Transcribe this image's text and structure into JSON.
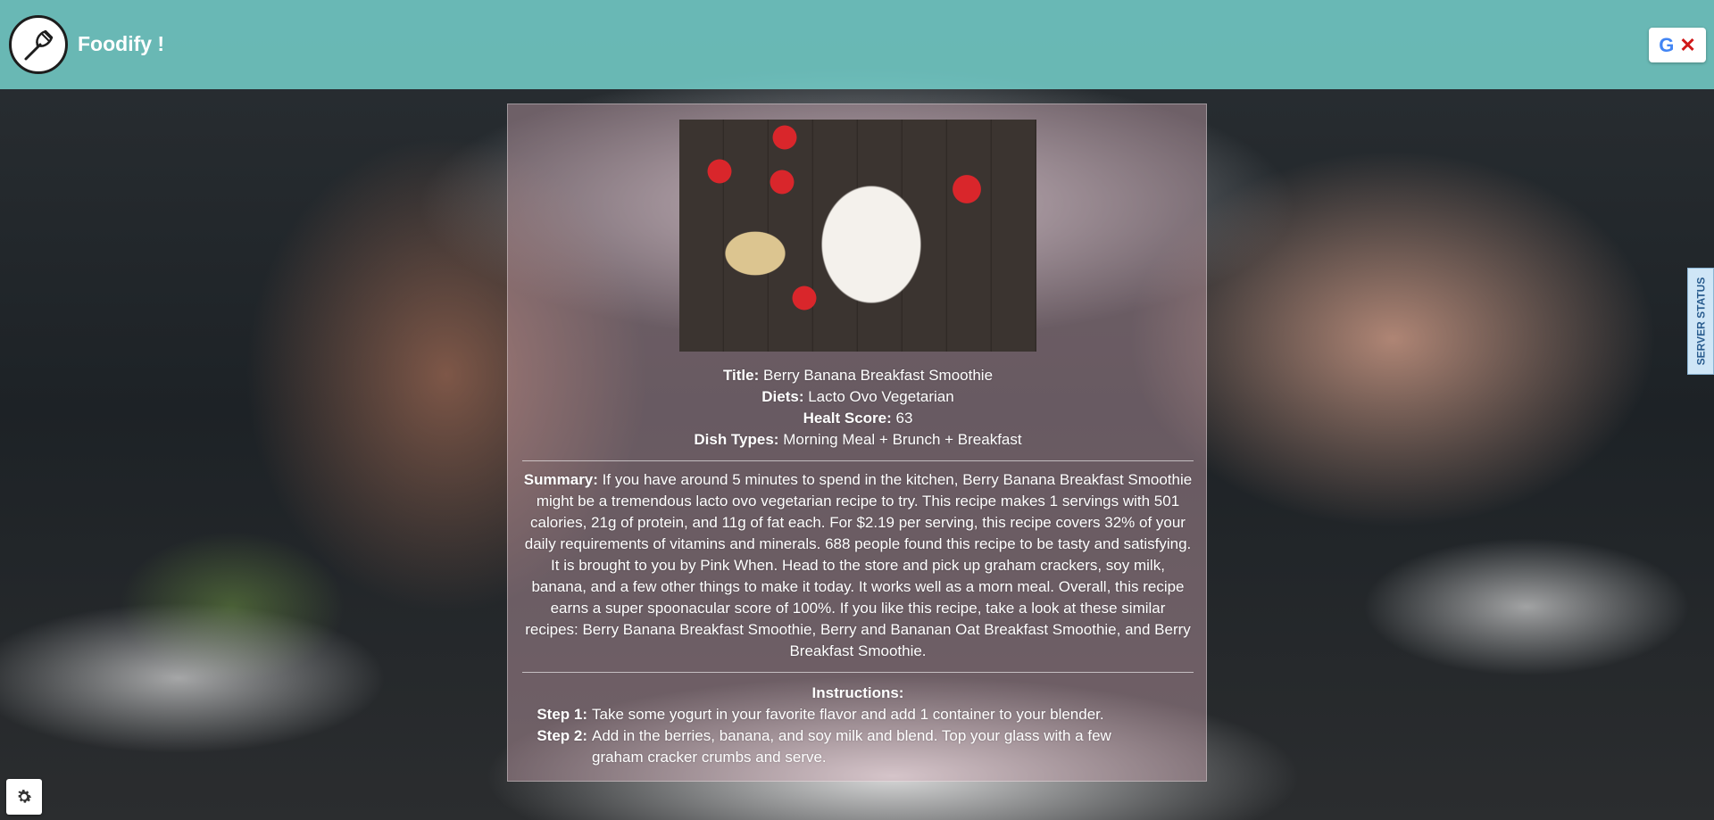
{
  "header": {
    "app_title": "Foodify !",
    "logo_icon": "fork-icon",
    "translate_icons": [
      "google-icon",
      "close-icon"
    ]
  },
  "sidebar": {
    "server_status_label": "SERVER STATUS"
  },
  "settings": {
    "icon": "gear-icon"
  },
  "recipe": {
    "title_label": "Title:",
    "title": "Berry Banana Breakfast Smoothie",
    "diets_label": "Diets:",
    "diets": "Lacto Ovo Vegetarian",
    "health_label": "Healt Score:",
    "health_score": "63",
    "dish_types_label": "Dish Types:",
    "dish_types": "Morning Meal + Brunch + Breakfast",
    "summary_label": "Summary:",
    "summary": "If you have around 5 minutes to spend in the kitchen, Berry Banana Breakfast Smoothie might be a tremendous lacto ovo vegetarian recipe to try. This recipe makes 1 servings with 501 calories, 21g of protein, and 11g of fat each. For $2.19 per serving, this recipe covers 32% of your daily requirements of vitamins and minerals. 688 people found this recipe to be tasty and satisfying. It is brought to you by Pink When. Head to the store and pick up graham crackers, soy milk, banana, and a few other things to make it today. It works well as a morn meal. Overall, this recipe earns a super spoonacular score of 100%. If you like this recipe, take a look at these similar recipes: Berry Banana Breakfast Smoothie, Berry and Bananan Oat Breakfast Smoothie, and Berry Breakfast Smoothie.",
    "instructions_label": "Instructions:",
    "steps": [
      {
        "label": "Step 1:",
        "text": "Take some yogurt in your favorite flavor and add 1 container to your blender."
      },
      {
        "label": "Step 2:",
        "text": "Add in the berries, banana, and soy milk and blend. Top your glass with a few graham cracker crumbs and serve."
      }
    ]
  },
  "colors": {
    "header_bg": "#78d7d2",
    "card_bg": "#d2aab4",
    "text": "#ffffff"
  }
}
